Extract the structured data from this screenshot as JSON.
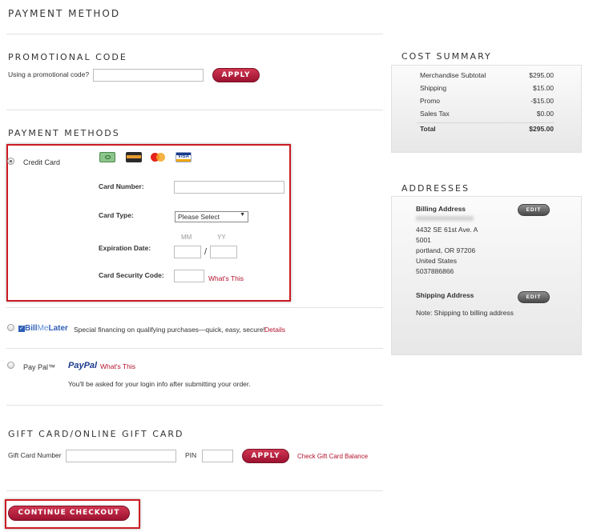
{
  "page_title": "PAYMENT METHOD",
  "promo": {
    "heading": "PROMOTIONAL CODE",
    "label": "Using a promotional code?",
    "apply": "APPLY"
  },
  "methods": {
    "heading": "PAYMENT METHODS",
    "credit_card": {
      "label": "Credit Card",
      "card_number_label": "Card Number:",
      "card_type_label": "Card Type:",
      "card_type_value": "Please Select",
      "expiration_label": "Expiration Date:",
      "mm": "MM",
      "yy": "YY",
      "slash": "/",
      "security_label": "Card Security Code:",
      "whats_this": "What's This",
      "icons": [
        "cash-card-icon",
        "discover-card-icon",
        "mastercard-icon",
        "visa-icon"
      ],
      "visa_text": "VISA"
    },
    "billmelater": {
      "brand_bill": "Bill",
      "brand_me": "Me",
      "brand_later": "Later",
      "text": "Special financing on qualifying purchases—quick, easy, secure!",
      "details": "Details"
    },
    "paypal": {
      "label": "Pay Pal™",
      "brand": "PayPal",
      "whats_this": "What's This",
      "note": "You'll be asked for your login info after submitting your order."
    }
  },
  "giftcard": {
    "heading": "GIFT CARD/ONLINE GIFT CARD",
    "number_label": "Gift Card Number",
    "pin_label": "PIN",
    "apply": "APPLY",
    "check_balance": "Check Gift Card Balance"
  },
  "continue": "CONTINUE CHECKOUT",
  "cost_summary": {
    "heading": "COST SUMMARY",
    "rows": [
      {
        "label": "Merchandise Subtotal",
        "value": "$295.00"
      },
      {
        "label": "Shipping",
        "value": "$15.00"
      },
      {
        "label": "Promo",
        "value": "-$15.00"
      },
      {
        "label": "Sales Tax",
        "value": "$0.00"
      }
    ],
    "total_label": "Total",
    "total_value": "$295.00"
  },
  "addresses": {
    "heading": "ADDRESSES",
    "billing_title": "Billing Address",
    "billing_lines": [
      "4432 SE 61st Ave. A",
      "5001",
      "portland, OR 97206",
      "United States",
      "5037886866"
    ],
    "shipping_title": "Shipping Address",
    "shipping_note": "Note: Shipping to billing address",
    "edit": "EDIT"
  },
  "colors": {
    "accent": "#b5122d",
    "highlight": "#cc1c24"
  }
}
